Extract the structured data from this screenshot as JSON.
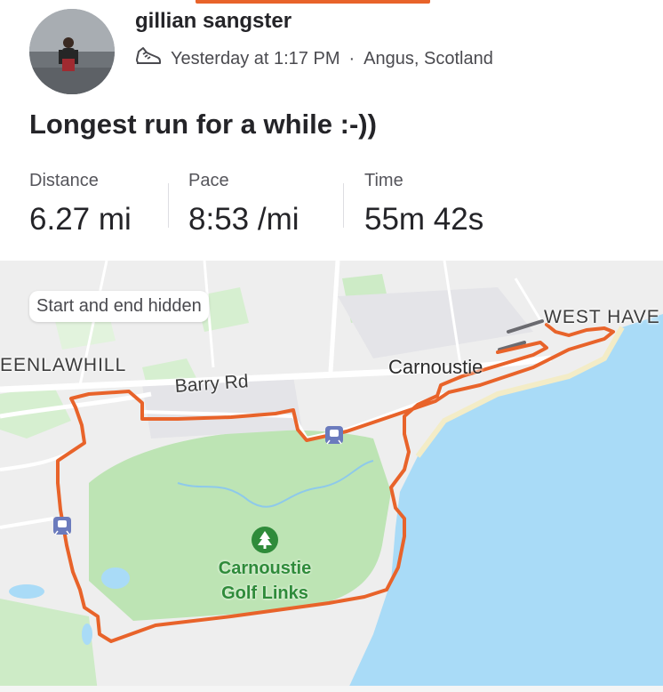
{
  "athlete": {
    "name": "gillian sangster",
    "timestamp": "Yesterday at 1:17 PM",
    "separator": "·",
    "location": "Angus, Scotland"
  },
  "activity": {
    "title": "Longest run for a while :-))"
  },
  "stats": [
    {
      "label": "Distance",
      "value": "6.27 mi"
    },
    {
      "label": "Pace",
      "value": "8:53 /mi"
    },
    {
      "label": "Time",
      "value": "55m 42s"
    }
  ],
  "map": {
    "privacy_chip": "Start and end hidden",
    "labels": {
      "west_haven": "WEST HAVE",
      "greenlawhill": "EENLAWHILL",
      "barry_rd": "Barry Rd",
      "carnoustie": "Carnoustie",
      "golf_links": "Carnoustie Golf Links"
    },
    "route_color": "#e8632a",
    "water_color": "#a9dbf7",
    "park_color": "#bde4b4"
  },
  "icons": {
    "activity_type": "running-shoe-icon",
    "park": "tree-icon",
    "station": "train-icon"
  },
  "colors": {
    "accent": "#e8632a",
    "text": "#242428"
  }
}
